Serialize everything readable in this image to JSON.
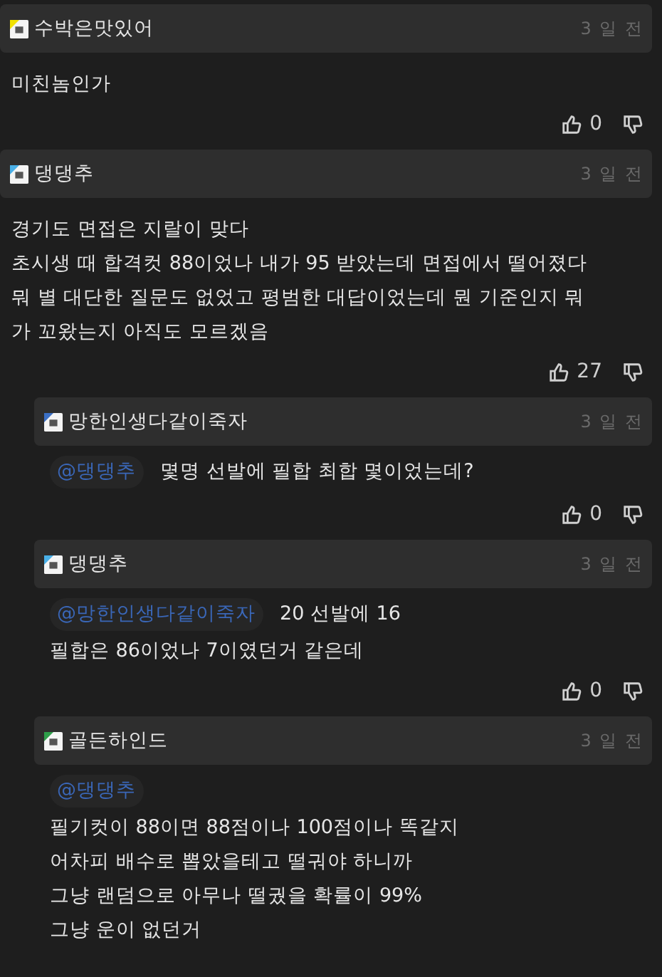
{
  "comments": [
    {
      "author": "수박은맛있어",
      "color": "#f2e200",
      "time": "3 일 전",
      "lines": [
        "미친놈인가"
      ],
      "likes": "0"
    },
    {
      "author": "댕댕추",
      "color": "#4ab0e8",
      "time": "3 일 전",
      "lines": [
        "경기도 면접은 지랄이 맞다",
        "초시생 때 합격컷 88이었나 내가 95 받았는데 면접에서 떨어졌다",
        "뭐 별 대단한 질문도 없었고 평범한 대답이었는데 뭔 기준인지 뭐",
        "가 꼬왔는지 아직도 모르겠음"
      ],
      "likes": "27",
      "children": [
        {
          "author": "망한인생다같이죽자",
          "color": "#3b6fc4",
          "time": "3 일 전",
          "mention": "@댕댕추",
          "kind": "inline",
          "lines": [
            "몇명 선발에 필합 최합 몇이었는데?"
          ],
          "likes": "0"
        },
        {
          "author": "댕댕추",
          "color": "#4ab0e8",
          "time": "3 일 전",
          "mention": "@망한인생다같이죽자",
          "kind": "inline",
          "lines": [
            "20 선발에 16",
            "필합은 86이었나 7이였던거 같은데"
          ],
          "likes": "0"
        },
        {
          "author": "골든하인드",
          "color": "#2e9e4a",
          "time": "3 일 전",
          "mention": "@댕댕추",
          "kind": "block",
          "lines": [
            "필기컷이 88이면 88점이나 100점이나 똑같지",
            "어차피 배수로 뽑았을테고 떨궈야 하니까",
            "그냥 랜덤으로 아무나 떨궜을 확률이 99%",
            "그냥 운이 없던거"
          ]
        }
      ]
    }
  ]
}
